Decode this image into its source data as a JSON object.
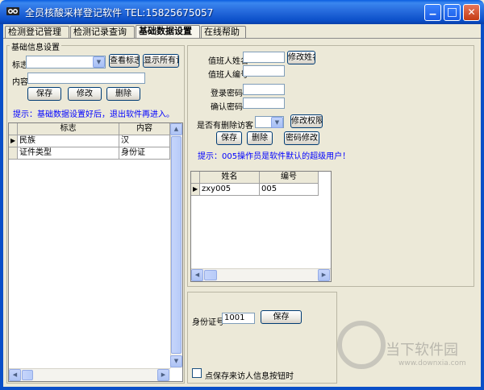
{
  "window": {
    "title": "全员核酸采样登记软件 TEL:15825675057",
    "min_glyph": "▁",
    "max_glyph": "□",
    "close_glyph": "✕"
  },
  "tabs": [
    {
      "label": "检测登记管理"
    },
    {
      "label": "检测记录查询"
    },
    {
      "label": "基础数据设置"
    },
    {
      "label": "在线帮助"
    }
  ],
  "basic_info": {
    "group_title": "基础信息设置",
    "flag_label": "标志",
    "content_label": "内容",
    "flag_value": "",
    "content_value": "",
    "view_flag_btn": "查看标志查询",
    "show_all_btn": "显示所有记录",
    "save_btn": "保存",
    "edit_btn": "修改",
    "delete_btn": "删除",
    "hint": "提示：基础数据设置好后，退出软件再进入。",
    "grid": {
      "headers": [
        "标志",
        "内容"
      ],
      "rows": [
        {
          "flag": "民族",
          "content": "汉"
        },
        {
          "flag": "证件类型",
          "content": "身份证"
        }
      ]
    }
  },
  "operator": {
    "name_label": "值班人姓名",
    "code_label": "值班人编号",
    "name_value": "",
    "code_value": "",
    "edit_name_btn": "修改姓名",
    "login_pwd_label": "登录密码",
    "confirm_pwd_label": "确认密码",
    "login_pwd_value": "",
    "confirm_pwd_value": "",
    "delete_perm_label": "是否有删除访客",
    "delete_perm_value": "",
    "edit_perm_btn": "修改权限",
    "save_btn": "保存",
    "delete_btn": "删除",
    "pwd_edit_btn": "密码修改",
    "hint": "提示：005操作员是软件默认的超级用户！",
    "grid": {
      "headers": [
        "姓名",
        "编号"
      ],
      "rows": [
        {
          "name": "zxy005",
          "code": "005"
        }
      ]
    }
  },
  "id_settings": {
    "id_label": "身份证号",
    "id_value": "1001",
    "save_btn": "保存",
    "save_visitor_label": "点保存来访人信息按钮时"
  },
  "watermark": {
    "text": "当下软件园",
    "url": "www.downxia.com"
  },
  "colors": {
    "accent_blue": "#0000ff",
    "titlebar": "#0a4fc8",
    "window_bg": "#ece9d8"
  }
}
